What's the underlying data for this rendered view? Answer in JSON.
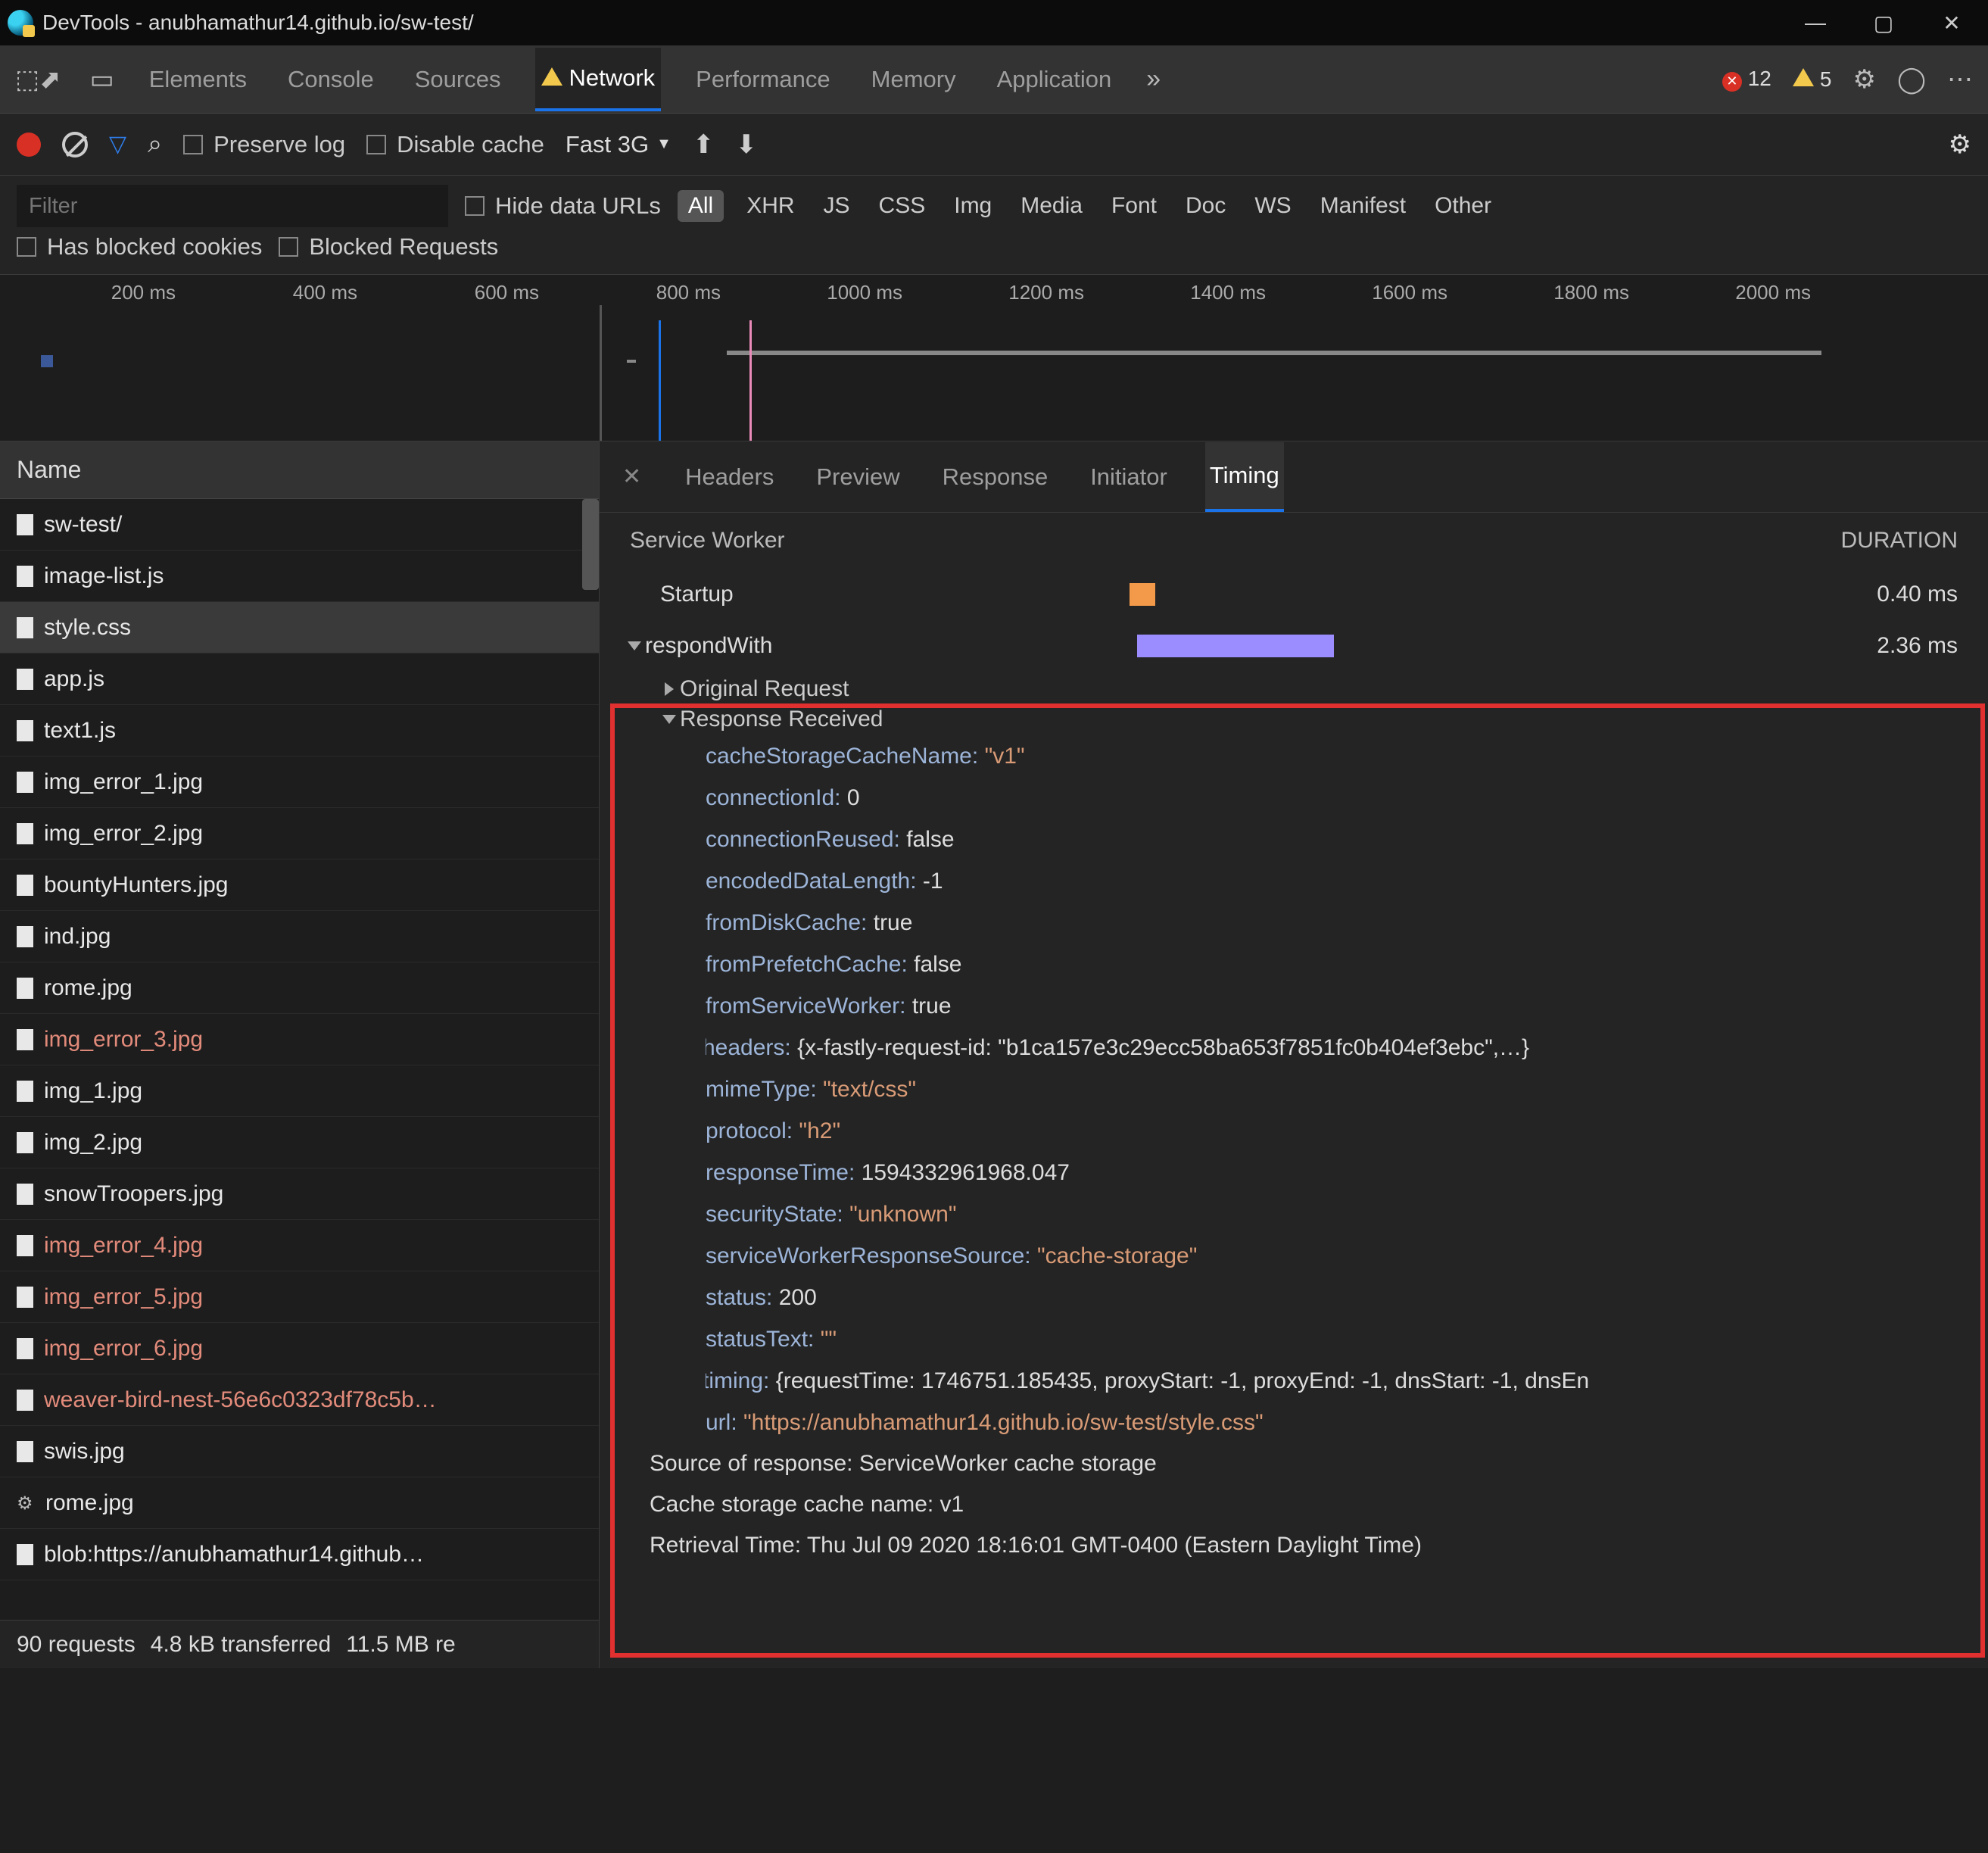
{
  "window": {
    "title": "DevTools - anubhamathur14.github.io/sw-test/"
  },
  "tabs": {
    "items": [
      "Elements",
      "Console",
      "Sources",
      "Network",
      "Performance",
      "Memory",
      "Application"
    ],
    "active": "Network",
    "errors": "12",
    "warnings": "5"
  },
  "toolbar": {
    "preserve_log": "Preserve log",
    "disable_cache": "Disable cache",
    "throttle": "Fast 3G"
  },
  "filter": {
    "placeholder": "Filter",
    "hide_data_urls": "Hide data URLs",
    "types": [
      "All",
      "XHR",
      "JS",
      "CSS",
      "Img",
      "Media",
      "Font",
      "Doc",
      "WS",
      "Manifest",
      "Other"
    ],
    "active_type": "All",
    "has_blocked_cookies": "Has blocked cookies",
    "blocked_requests": "Blocked Requests"
  },
  "timeline_ticks": [
    "200 ms",
    "400 ms",
    "600 ms",
    "800 ms",
    "1000 ms",
    "1200 ms",
    "1400 ms",
    "1600 ms",
    "1800 ms",
    "2000 ms"
  ],
  "name_header": "Name",
  "files": [
    {
      "name": "sw-test/",
      "err": false,
      "gear": false
    },
    {
      "name": "image-list.js",
      "err": false,
      "gear": false
    },
    {
      "name": "style.css",
      "err": false,
      "gear": false,
      "selected": true
    },
    {
      "name": "app.js",
      "err": false,
      "gear": false
    },
    {
      "name": "text1.js",
      "err": false,
      "gear": false
    },
    {
      "name": "img_error_1.jpg",
      "err": false,
      "gear": false
    },
    {
      "name": "img_error_2.jpg",
      "err": false,
      "gear": false
    },
    {
      "name": "bountyHunters.jpg",
      "err": false,
      "gear": false
    },
    {
      "name": "ind.jpg",
      "err": false,
      "gear": false
    },
    {
      "name": "rome.jpg",
      "err": false,
      "gear": false
    },
    {
      "name": "img_error_3.jpg",
      "err": true,
      "gear": false
    },
    {
      "name": "img_1.jpg",
      "err": false,
      "gear": false
    },
    {
      "name": "img_2.jpg",
      "err": false,
      "gear": false
    },
    {
      "name": "snowTroopers.jpg",
      "err": false,
      "gear": false
    },
    {
      "name": "img_error_4.jpg",
      "err": true,
      "gear": false
    },
    {
      "name": "img_error_5.jpg",
      "err": true,
      "gear": false
    },
    {
      "name": "img_error_6.jpg",
      "err": true,
      "gear": false
    },
    {
      "name": "weaver-bird-nest-56e6c0323df78c5b…",
      "err": true,
      "gear": false
    },
    {
      "name": "swis.jpg",
      "err": false,
      "gear": false
    },
    {
      "name": "rome.jpg",
      "err": false,
      "gear": true
    },
    {
      "name": "blob:https://anubhamathur14.github…",
      "err": false,
      "gear": false
    }
  ],
  "detail_tabs": {
    "items": [
      "Headers",
      "Preview",
      "Response",
      "Initiator",
      "Timing"
    ],
    "active": "Timing"
  },
  "sw": {
    "head_label": "Service Worker",
    "head_duration": "DURATION",
    "startup_label": "Startup",
    "startup_val": "0.40 ms",
    "respond_label": "respondWith",
    "respond_val": "2.36 ms",
    "orig_req": "Original Request",
    "resp_recv": "Response Received"
  },
  "kv": [
    {
      "k": "cacheStorageCacheName:",
      "v": "\"v1\"",
      "str": true
    },
    {
      "k": "connectionId:",
      "v": "0",
      "str": false
    },
    {
      "k": "connectionReused:",
      "v": "false",
      "str": false
    },
    {
      "k": "encodedDataLength:",
      "v": "-1",
      "str": false
    },
    {
      "k": "fromDiskCache:",
      "v": "true",
      "str": false
    },
    {
      "k": "fromPrefetchCache:",
      "v": "false",
      "str": false
    },
    {
      "k": "fromServiceWorker:",
      "v": "true",
      "str": false
    },
    {
      "k": "headers:",
      "v": "{x-fastly-request-id: \"b1ca157e3c29ecc58ba653f7851fc0b404ef3ebc\",…}",
      "str": false,
      "tri": true
    },
    {
      "k": "mimeType:",
      "v": "\"text/css\"",
      "str": true
    },
    {
      "k": "protocol:",
      "v": "\"h2\"",
      "str": true
    },
    {
      "k": "responseTime:",
      "v": "1594332961968.047",
      "str": false
    },
    {
      "k": "securityState:",
      "v": "\"unknown\"",
      "str": true
    },
    {
      "k": "serviceWorkerResponseSource:",
      "v": "\"cache-storage\"",
      "str": true
    },
    {
      "k": "status:",
      "v": "200",
      "str": false
    },
    {
      "k": "statusText:",
      "v": "\"\"",
      "str": true
    },
    {
      "k": "timing:",
      "v": "{requestTime: 1746751.185435, proxyStart: -1, proxyEnd: -1, dnsStart: -1, dnsEn",
      "str": false,
      "tri": true
    },
    {
      "k": "url:",
      "v": "\"https://anubhamathur14.github.io/sw-test/style.css\"",
      "str": true
    }
  ],
  "footer_lines": {
    "source": "Source of response: ServiceWorker cache storage",
    "cache": "Cache storage cache name: v1",
    "retrieval": "Retrieval Time: Thu Jul 09 2020 18:16:01 GMT-0400 (Eastern Daylight Time)"
  },
  "status": {
    "requests": "90 requests",
    "transferred": "4.8 kB transferred",
    "resources": "11.5 MB re"
  }
}
